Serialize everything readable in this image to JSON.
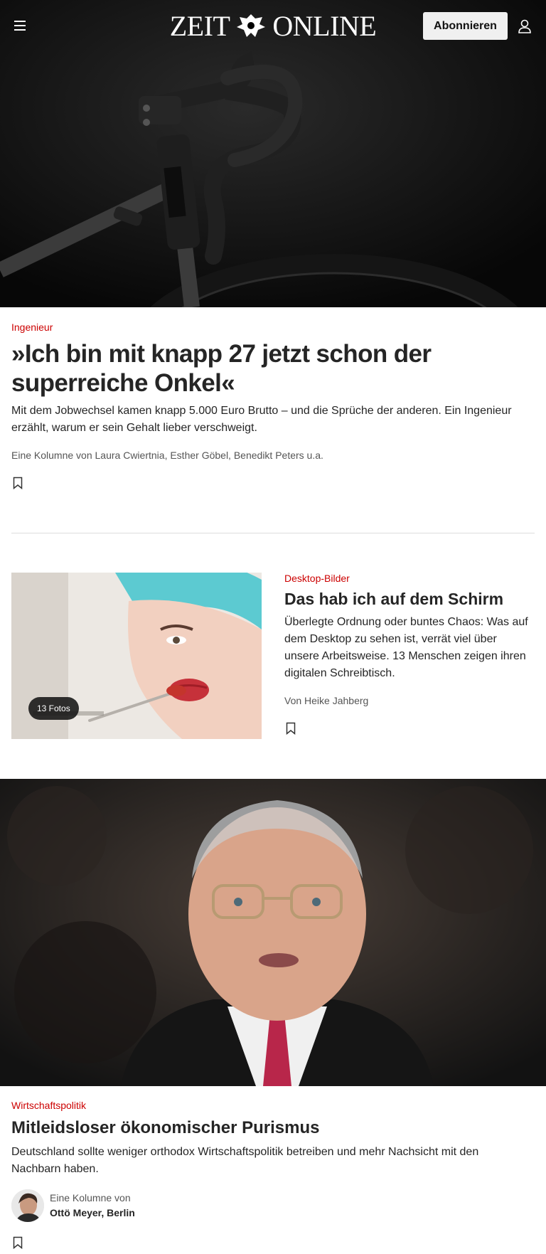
{
  "header": {
    "logo_left": "ZEIT",
    "logo_right": "ONLINE",
    "subscribe_label": "Abonnieren",
    "menu_icon": "hamburger-icon",
    "user_icon": "user-icon"
  },
  "articles": [
    {
      "kicker": "Ingenieur",
      "headline": "»Ich bin mit knapp 27 jetzt schon der superreiche Onkel«",
      "summary": "Mit dem Jobwechsel kamen knapp 5.000 Euro Brutto – und die Sprüche der anderen. Ein Ingenieur erzählt, warum er sein Gehalt lieber verschweigt.",
      "author": "Eine Kolumne von Laura Cwiertnia, Esther Göbel, Benedikt Peters u.a."
    },
    {
      "kicker": "Desktop-Bilder",
      "headline": "Das hab ich auf dem Schirm",
      "summary": "Überlegte Ordnung oder buntes Chaos: Was auf dem Desktop zu sehen ist, verrät viel über unsere Arbeitsweise. 13 Menschen zeigen ihren digitalen Schreibtisch.",
      "author": "Von Heike Jahberg",
      "badge": "13 Fotos"
    },
    {
      "kicker": "Wirtschaftspolitik",
      "headline": "Mitleidsloser ökonomischer Purismus",
      "summary": "Deutschland sollte weniger orthodox Wirtschaftspolitik betreiben und mehr Nachsicht mit den Nachbarn haben.",
      "column_intro": "Eine Kolumne von",
      "column_author": "Ottö Meyer, Berlin"
    }
  ],
  "colors": {
    "kicker": "#cc0000",
    "header_bg": "#000000",
    "text": "#252525"
  }
}
